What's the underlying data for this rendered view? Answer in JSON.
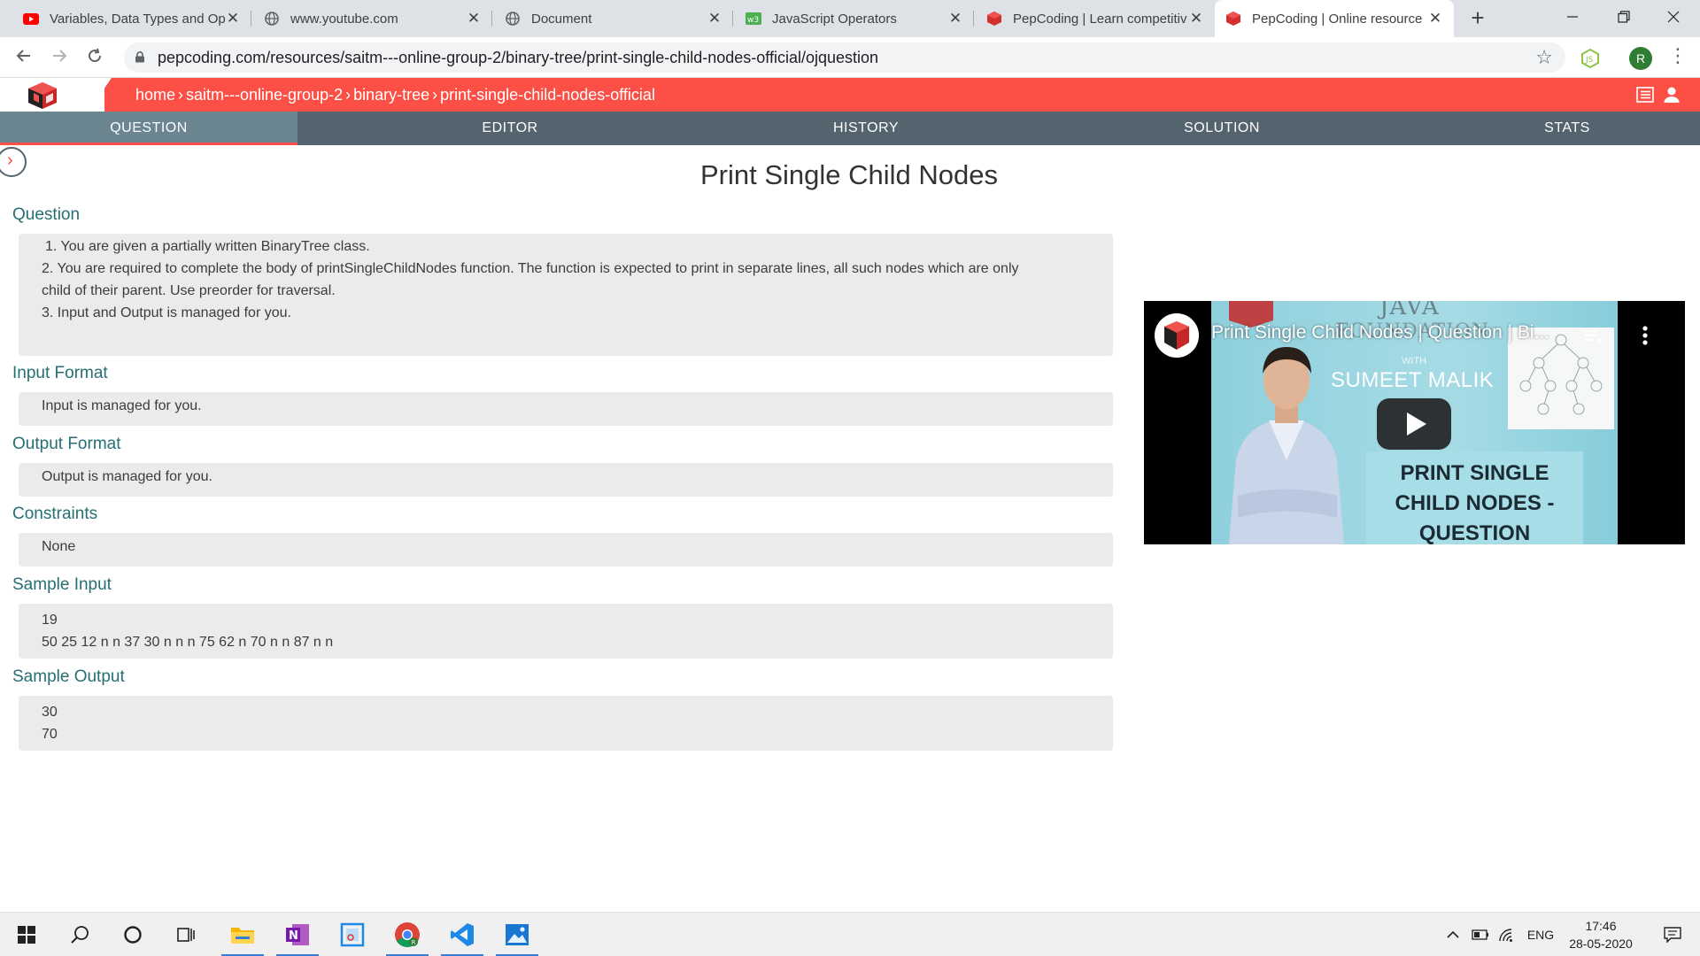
{
  "browser": {
    "tabs": [
      {
        "title": "Variables, Data Types and Op",
        "favicon": "youtube-icon",
        "active": false
      },
      {
        "title": "www.youtube.com",
        "favicon": "globe-icon",
        "active": false
      },
      {
        "title": "Document",
        "favicon": "globe-icon",
        "active": false
      },
      {
        "title": "JavaScript Operators",
        "favicon": "w3schools-icon",
        "active": false
      },
      {
        "title": "PepCoding | Learn competitiv",
        "favicon": "pepcoding-icon",
        "active": false
      },
      {
        "title": "PepCoding | Online resource",
        "favicon": "pepcoding-icon",
        "active": true
      }
    ],
    "new_tab_label": "+",
    "close_label": "✕",
    "url": "pepcoding.com/resources/saitm---online-group-2/binary-tree/print-single-child-nodes-official/ojquestion",
    "profile_initial": "R"
  },
  "site": {
    "breadcrumb": [
      "home",
      "saitm---online-group-2",
      "binary-tree",
      "print-single-child-nodes-official"
    ],
    "tabs": [
      "QUESTION",
      "EDITOR",
      "HISTORY",
      "SOLUTION",
      "STATS"
    ],
    "active_tab": "QUESTION"
  },
  "problem": {
    "title": "Print Single Child Nodes",
    "question_heading": "Question",
    "question_items": [
      "1. You are given a partially written BinaryTree class.",
      "2. You are required to complete the body of printSingleChildNodes function. The function is expected to print in separate lines, all such nodes which are only",
      "child of their parent. Use preorder for traversal.",
      "3. Input and Output is managed for you."
    ],
    "input_format_heading": "Input Format",
    "input_format": "Input is managed for you.",
    "output_format_heading": "Output Format",
    "output_format": "Output is managed for you.",
    "constraints_heading": "Constraints",
    "constraints": "None",
    "sample_input_heading": "Sample Input",
    "sample_input": [
      "19",
      "50 25 12 n n 37 30 n n n 75 62 n 70 n n 87 n n"
    ],
    "sample_output_heading": "Sample Output",
    "sample_output": [
      "30",
      "70"
    ]
  },
  "video": {
    "title": "Print Single Child Nodes | Question | Bi...",
    "overlay_top": "JAVA",
    "overlay_sub": "FOUNDATION",
    "with_text": "WITH",
    "presenter": "SUMEET MALIK",
    "card_lines": [
      "PRINT SINGLE",
      "CHILD NODES -",
      "QUESTION"
    ]
  },
  "taskbar": {
    "apps": [
      "windows-start-icon",
      "search-icon",
      "cortana-icon",
      "task-view-icon",
      "file-explorer-icon",
      "onenote-icon",
      "snipping-tool-icon",
      "chrome-icon",
      "vscode-icon",
      "photos-icon"
    ],
    "language": "ENG",
    "time": "17:46",
    "date": "28-05-2020"
  },
  "colors": {
    "header_red": "#fc4f45",
    "nav_slate": "#53646f",
    "nav_active": "#6b8591",
    "section_teal": "#256f73",
    "box_gray": "#ebebeb"
  }
}
